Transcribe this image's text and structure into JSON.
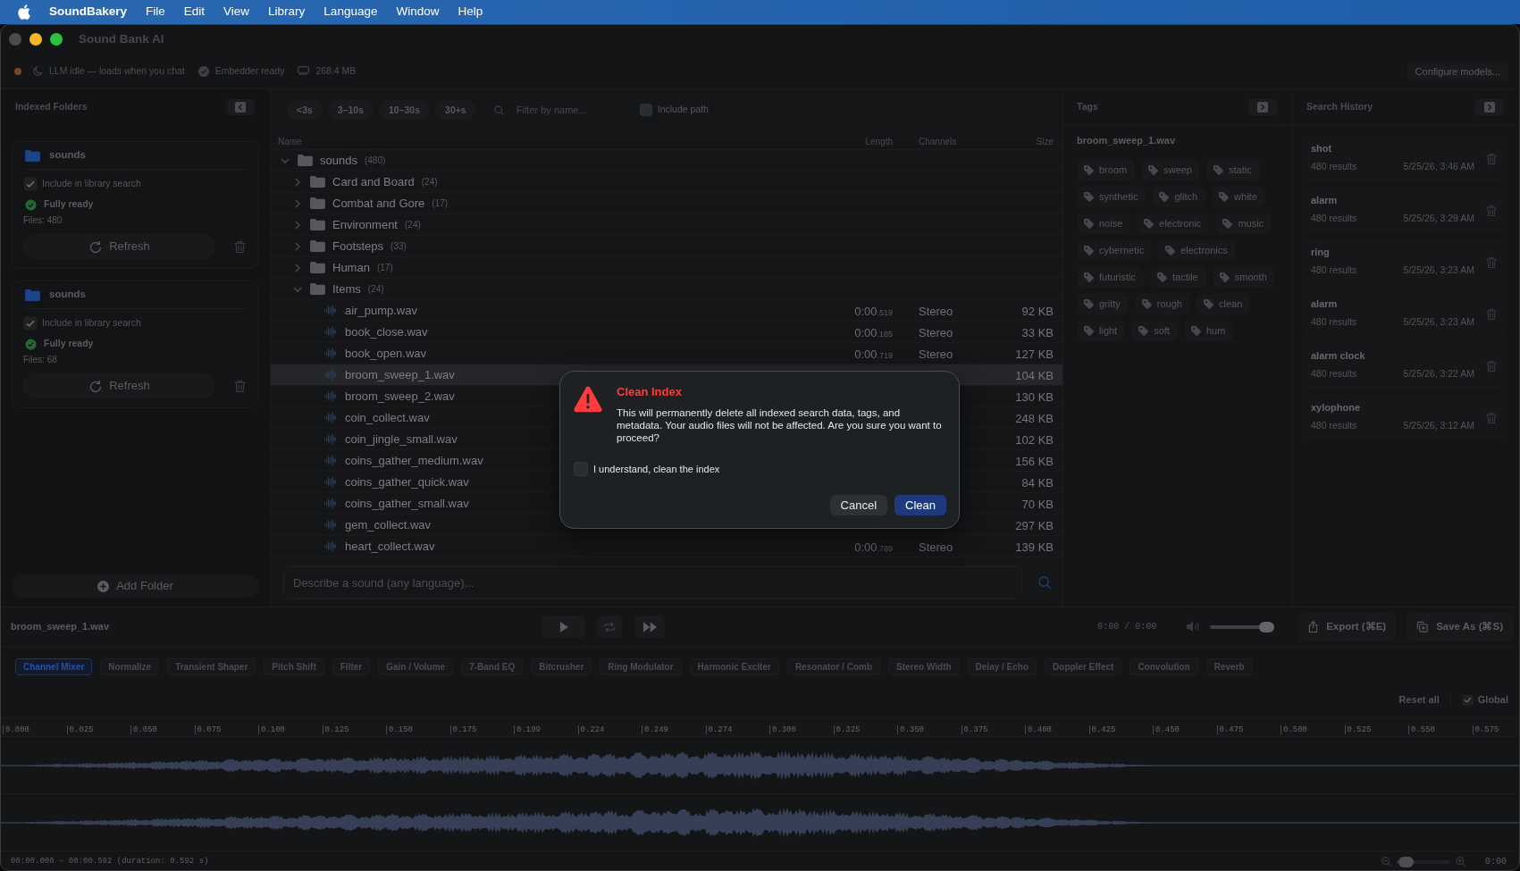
{
  "menu_bar": {
    "app_name": "SoundBakery",
    "items": [
      "File",
      "Edit",
      "View",
      "Library",
      "Language",
      "Window",
      "Help"
    ]
  },
  "window": {
    "title": "Sound Bank AI"
  },
  "status": {
    "items": [
      {
        "kind": "llm",
        "color": "#7b4523",
        "text": "LLM idle — loads when you chat"
      },
      {
        "kind": "embedder",
        "text": "Embedder ready"
      },
      {
        "kind": "memory",
        "text": "268.4 MB"
      }
    ],
    "configure_button": "Configure models..."
  },
  "sidebar": {
    "title": "Indexed Folders",
    "folders": [
      {
        "name": "sounds",
        "include_label": "Include in library search",
        "included": true,
        "status": "Fully ready",
        "files": "Files: 480",
        "refresh_label": "Refresh"
      },
      {
        "name": "sounds",
        "include_label": "Include in library search",
        "included": true,
        "status": "Fully ready",
        "files": "Files: 68",
        "refresh_label": "Refresh"
      }
    ],
    "add_button": "Add Folder"
  },
  "filters": {
    "duration_chips": [
      {
        "label": "<3s",
        "selected": false
      },
      {
        "label": "3–10s",
        "selected": false
      },
      {
        "label": "10–30s",
        "selected": false
      },
      {
        "label": "30+s",
        "selected": false
      }
    ],
    "search_placeholder": "Filter by name...",
    "include_path": {
      "label": "Include path",
      "checked": false
    }
  },
  "file_table": {
    "columns": [
      "Name",
      "Length",
      "Channels",
      "Size"
    ],
    "rows": [
      {
        "kind": "folder",
        "name": "sounds",
        "count": "(480)",
        "expanded": true,
        "children": [
          {
            "kind": "folder",
            "name": "Card and Board",
            "count": "(24)",
            "expanded": false
          },
          {
            "kind": "folder",
            "name": "Combat and Gore",
            "count": "(17)",
            "expanded": false
          },
          {
            "kind": "folder",
            "name": "Environment",
            "count": "(24)",
            "expanded": false
          },
          {
            "kind": "folder",
            "name": "Footsteps",
            "count": "(33)",
            "expanded": false
          },
          {
            "kind": "folder",
            "name": "Human",
            "count": "(17)",
            "expanded": false
          },
          {
            "kind": "folder",
            "name": "Items",
            "count": "(24)",
            "expanded": true,
            "children": [
              {
                "kind": "file",
                "name": "air_pump.wav",
                "length": "0:00",
                "length_fraction": ".519",
                "channels": "Stereo",
                "size": "92 KB",
                "selected": false
              },
              {
                "kind": "file",
                "name": "book_close.wav",
                "length": "0:00",
                "length_fraction": ".185",
                "channels": "Stereo",
                "size": "33 KB",
                "selected": false
              },
              {
                "kind": "file",
                "name": "book_open.wav",
                "length": "0:00",
                "length_fraction": ".719",
                "channels": "Stereo",
                "size": "127 KB",
                "selected": false
              },
              {
                "kind": "file",
                "name": "broom_sweep_1.wav",
                "size": "104 KB",
                "selected": true
              },
              {
                "kind": "file",
                "name": "broom_sweep_2.wav",
                "size": "130 KB",
                "selected": false
              },
              {
                "kind": "file",
                "name": "coin_collect.wav",
                "size": "248 KB",
                "selected": false
              },
              {
                "kind": "file",
                "name": "coin_jingle_small.wav",
                "size": "102 KB",
                "selected": false
              },
              {
                "kind": "file",
                "name": "coins_gather_medium.wav",
                "size": "156 KB",
                "selected": false
              },
              {
                "kind": "file",
                "name": "coins_gather_quick.wav",
                "size": "84 KB",
                "selected": false
              },
              {
                "kind": "file",
                "name": "coins_gather_small.wav",
                "size": "70 KB",
                "selected": false
              },
              {
                "kind": "file",
                "name": "gem_collect.wav",
                "size": "297 KB",
                "selected": false
              },
              {
                "kind": "file",
                "name": "heart_collect.wav",
                "length": "0:00",
                "length_fraction": ".789",
                "channels": "Stereo",
                "size": "139 KB",
                "selected": false
              }
            ]
          }
        ]
      }
    ]
  },
  "prompt": {
    "placeholder": "Describe a sound (any language)..."
  },
  "tags_panel": {
    "title": "Tags",
    "file": "broom_sweep_1.wav",
    "tags": [
      "broom",
      "sweep",
      "static",
      "synthetic",
      "glitch",
      "white",
      "noise",
      "electronic",
      "music",
      "cybernetic",
      "electronics",
      "futuristic",
      "tactile",
      "smooth",
      "gritty",
      "rough",
      "clean",
      "light",
      "soft",
      "hum"
    ]
  },
  "history_panel": {
    "title": "Search History",
    "entries": [
      {
        "query": "shot",
        "results": "480 results",
        "time": "5/25/26, 3:46 AM"
      },
      {
        "query": "alarm",
        "results": "480 results",
        "time": "5/25/26, 3:29 AM"
      },
      {
        "query": "ring",
        "results": "480 results",
        "time": "5/25/26, 3:23 AM"
      },
      {
        "query": "alarm",
        "results": "480 results",
        "time": "5/25/26, 3:23 AM"
      },
      {
        "query": "alarm clock",
        "results": "480 results",
        "time": "5/25/26, 3:22 AM"
      },
      {
        "query": "xylophone",
        "results": "480 results",
        "time": "5/25/26, 3:12 AM"
      }
    ]
  },
  "player": {
    "file": "broom_sweep_1.wav",
    "time": "0:00 / 0:00",
    "volume": {
      "level": 1
    },
    "export_button": "Export (⌘E)",
    "save_button": "Save As (⌘S)"
  },
  "effects": {
    "tabs": [
      {
        "label": "Channel Mixer",
        "selected": true
      },
      {
        "label": "Normalize",
        "selected": false
      },
      {
        "label": "Transient Shaper",
        "selected": false
      },
      {
        "label": "Pitch Shift",
        "selected": false
      },
      {
        "label": "Filter",
        "selected": false
      },
      {
        "label": "Gain / Volume",
        "selected": false
      },
      {
        "label": "7-Band EQ",
        "selected": false
      },
      {
        "label": "Bitcrusher",
        "selected": false
      },
      {
        "label": "Ring Modulator",
        "selected": false
      },
      {
        "label": "Harmonic Exciter",
        "selected": false
      },
      {
        "label": "Resonator / Comb",
        "selected": false
      },
      {
        "label": "Stereo Width",
        "selected": false
      },
      {
        "label": "Delay / Echo",
        "selected": false
      },
      {
        "label": "Doppler Effect",
        "selected": false
      },
      {
        "label": "Convolution",
        "selected": false
      },
      {
        "label": "Reverb",
        "selected": false
      }
    ],
    "reset_label": "Reset all",
    "global": {
      "label": "Global",
      "checked": true
    }
  },
  "timeline": {
    "ruler_labels": [
      "0.000",
      "0.025",
      "0.050",
      "0.075",
      "0.100",
      "0.125",
      "0.150",
      "0.175",
      "0.199",
      "0.224",
      "0.249",
      "0.274",
      "0.300",
      "0.325",
      "0.350",
      "0.375",
      "0.400",
      "0.425",
      "0.450",
      "0.475",
      "0.500",
      "0.525",
      "0.550",
      "0.575"
    ],
    "range": "00:00.000 – 00:00.592 (duration: 0.592 s)",
    "zoom": {
      "level": 0.04
    },
    "end_label": "0:00"
  },
  "dialog": {
    "title": "Clean Index",
    "message": "This will permanently delete all indexed search data, tags, and metadata. Your audio files will not be affected. Are you sure you want to proceed?",
    "confirm": {
      "label": "I understand, clean the index",
      "checked": false
    },
    "buttons": [
      {
        "label": "Cancel",
        "kind": "secondary"
      },
      {
        "label": "Clean",
        "kind": "primary"
      }
    ]
  }
}
